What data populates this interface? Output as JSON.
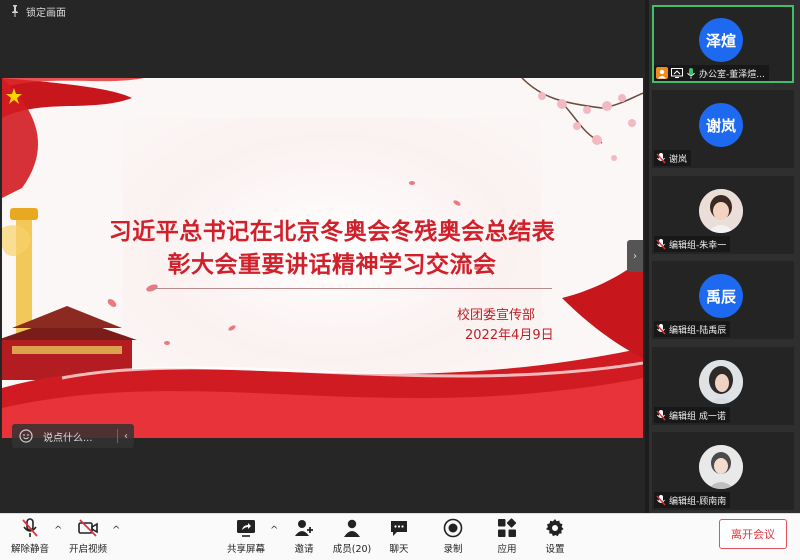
{
  "lock": {
    "label": "锁定画面"
  },
  "slide": {
    "title_line1": "习近平总书记在北京冬奥会冬残奥会总结表",
    "title_line2": "彰大会重要讲话精神学习交流会",
    "org": "校团委宣传部",
    "date": "2022年4月9日"
  },
  "chat_chip": {
    "placeholder": "说点什么..."
  },
  "participants": [
    {
      "avatar_text": "泽煊",
      "name": "办公室-董泽煊...",
      "host": true,
      "sharing": true,
      "mic": "on"
    },
    {
      "avatar_text": "谢岚",
      "name": "谢岚",
      "mic": "muted"
    },
    {
      "avatar_text": "",
      "name": "编辑组-朱幸一",
      "mic": "muted"
    },
    {
      "avatar_text": "禹辰",
      "name": "编辑组-陆禹辰",
      "mic": "muted"
    },
    {
      "avatar_text": "",
      "name": "编辑组 成一诺",
      "mic": "muted"
    },
    {
      "avatar_text": "",
      "name": "编辑组-顾南南",
      "mic": "muted"
    }
  ],
  "toolbar": {
    "unmute": "解除静音",
    "video": "开启视频",
    "share": "共享屏幕",
    "invite": "邀请",
    "members": "成员(20)",
    "chat": "聊天",
    "record": "录制",
    "apps": "应用",
    "settings": "设置",
    "leave": "离开会议"
  },
  "colors": {
    "accent_blue": "#1d6af0",
    "title_red": "#d0202a",
    "leave_red": "#e0323c",
    "active_green": "#3fbf6a"
  }
}
